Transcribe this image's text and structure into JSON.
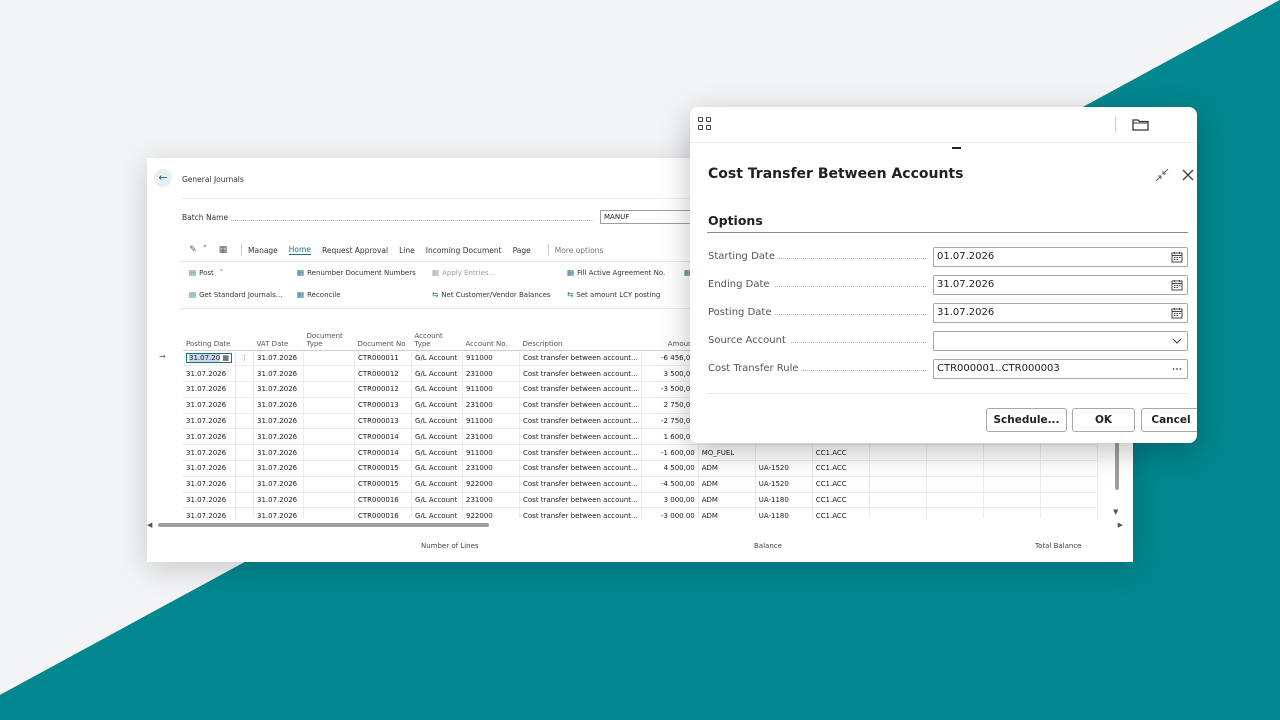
{
  "journal": {
    "title": "General Journals",
    "batch_label": "Batch Name",
    "batch_value": "MANUF",
    "actions": [
      "Manage",
      "Home",
      "Request Approval",
      "Line",
      "Incoming Document",
      "Page",
      "More options"
    ],
    "ribbon": {
      "post": "Post",
      "get_standard": "Get Standard Journals...",
      "renumber": "Renumber Document Numbers",
      "reconcile": "Reconcile",
      "apply_entries": "Apply Entries...",
      "net_balances": "Net Customer/Vendor Balances",
      "fill_agreement": "Fill Active Agreement No.",
      "set_amount": "Set amount LCY posting"
    },
    "columns": {
      "posting_date": "Posting Date",
      "vat_date": "VAT Date",
      "document_type": "Document Type",
      "document_no": "Document No",
      "account_type": "Account Type",
      "account_no": "Account No.",
      "description": "Description",
      "amount": "Amount"
    },
    "first_row_edit": "31.07.20",
    "rows": [
      {
        "posting": "31.07.2026",
        "vat": "31.07.2026",
        "doc": "CTR000011",
        "acct_type": "G/L Account",
        "acct": "911000",
        "desc": "Cost transfer between account...",
        "amount": "-6 456,00",
        "c9": "",
        "c10": "",
        "c11": ""
      },
      {
        "posting": "31.07.2026",
        "vat": "31.07.2026",
        "doc": "CTR000012",
        "acct_type": "G/L Account",
        "acct": "231000",
        "desc": "Cost transfer between account...",
        "amount": "3 500,00",
        "c9": "",
        "c10": "",
        "c11": ""
      },
      {
        "posting": "31.07.2026",
        "vat": "31.07.2026",
        "doc": "CTR000012",
        "acct_type": "G/L Account",
        "acct": "911000",
        "desc": "Cost transfer between account...",
        "amount": "-3 500,00",
        "c9": "",
        "c10": "",
        "c11": ""
      },
      {
        "posting": "31.07.2026",
        "vat": "31.07.2026",
        "doc": "CTR000013",
        "acct_type": "G/L Account",
        "acct": "231000",
        "desc": "Cost transfer between account...",
        "amount": "2 750,00",
        "c9": "",
        "c10": "",
        "c11": ""
      },
      {
        "posting": "31.07.2026",
        "vat": "31.07.2026",
        "doc": "CTR000013",
        "acct_type": "G/L Account",
        "acct": "911000",
        "desc": "Cost transfer between account...",
        "amount": "-2 750,00",
        "c9": "",
        "c10": "",
        "c11": ""
      },
      {
        "posting": "31.07.2026",
        "vat": "31.07.2026",
        "doc": "CTR000014",
        "acct_type": "G/L Account",
        "acct": "231000",
        "desc": "Cost transfer between account...",
        "amount": "1 600,00",
        "c9": "",
        "c10": "",
        "c11": ""
      },
      {
        "posting": "31.07.2026",
        "vat": "31.07.2026",
        "doc": "CTR000014",
        "acct_type": "G/L Account",
        "acct": "911000",
        "desc": "Cost transfer between account...",
        "amount": "-1 600,00",
        "c9": "MO_FUEL",
        "c10": "",
        "c11": "CC1.ACC"
      },
      {
        "posting": "31.07.2026",
        "vat": "31.07.2026",
        "doc": "CTR000015",
        "acct_type": "G/L Account",
        "acct": "231000",
        "desc": "Cost transfer between account...",
        "amount": "4 500,00",
        "c9": "ADM",
        "c10": "UA-1520",
        "c11": "CC1.ACC"
      },
      {
        "posting": "31.07.2026",
        "vat": "31.07.2026",
        "doc": "CTR000015",
        "acct_type": "G/L Account",
        "acct": "922000",
        "desc": "Cost transfer between account...",
        "amount": "-4 500,00",
        "c9": "ADM",
        "c10": "UA-1520",
        "c11": "CC1.ACC"
      },
      {
        "posting": "31.07.2026",
        "vat": "31.07.2026",
        "doc": "CTR000016",
        "acct_type": "G/L Account",
        "acct": "231000",
        "desc": "Cost transfer between account...",
        "amount": "3 000,00",
        "c9": "ADM",
        "c10": "UA-1180",
        "c11": "CC1.ACC"
      },
      {
        "posting": "31.07.2026",
        "vat": "31.07.2026",
        "doc": "CTR000016",
        "acct_type": "G/L Account",
        "acct": "922000",
        "desc": "Cost transfer between account...",
        "amount": "-3 000,00",
        "c9": "ADM",
        "c10": "UA-1180",
        "c11": "CC1.ACC"
      }
    ],
    "footer": {
      "lines": "Number of Lines",
      "balance": "Balance",
      "total": "Total Balance"
    }
  },
  "dialog": {
    "title": "Cost Transfer Between Accounts",
    "section": "Options",
    "fields": [
      {
        "label": "Starting Date",
        "value": "01.07.2026",
        "suffix": "calendar-icon"
      },
      {
        "label": "Ending Date",
        "value": "31.07.2026",
        "suffix": "calendar-icon"
      },
      {
        "label": "Posting Date",
        "value": "31.07.2026",
        "suffix": "calendar-icon"
      },
      {
        "label": "Source Account",
        "value": "",
        "suffix": "chevron-down-icon"
      },
      {
        "label": "Cost Transfer Rule",
        "value": "CTR000001..CTR000003",
        "suffix": "ellipsis-icon"
      }
    ],
    "buttons": {
      "schedule": "Schedule...",
      "ok": "OK",
      "cancel": "Cancel"
    }
  },
  "colors": {
    "teal": "#00878f",
    "accent": "#1a6f80"
  }
}
